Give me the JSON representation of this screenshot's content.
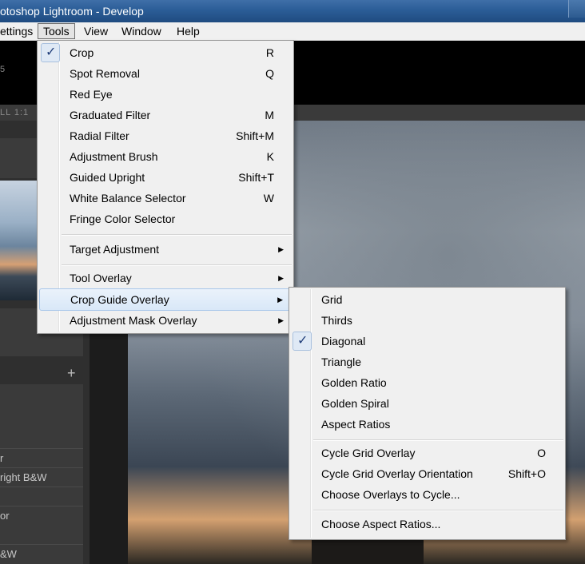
{
  "window": {
    "title": "otoshop Lightroom - Develop"
  },
  "menubar": {
    "items": [
      "ettings",
      "Tools",
      "View",
      "Window",
      "Help"
    ]
  },
  "lightroom": {
    "panel_hint": "5",
    "zoom_strip": "LL  1:1",
    "presets": [
      "r",
      "right B&W",
      "",
      "or",
      "&W"
    ]
  },
  "tools_menu": {
    "items": [
      {
        "label": "Crop",
        "shortcut": "R",
        "checked": true
      },
      {
        "label": "Spot Removal",
        "shortcut": "Q"
      },
      {
        "label": "Red Eye",
        "shortcut": ""
      },
      {
        "label": "Graduated Filter",
        "shortcut": "M"
      },
      {
        "label": "Radial Filter",
        "shortcut": "Shift+M"
      },
      {
        "label": "Adjustment Brush",
        "shortcut": "K"
      },
      {
        "label": "Guided Upright",
        "shortcut": "Shift+T"
      },
      {
        "label": "White Balance Selector",
        "shortcut": "W"
      },
      {
        "label": "Fringe Color Selector",
        "shortcut": ""
      }
    ],
    "target_adjustment": "Target Adjustment",
    "tool_overlay": "Tool Overlay",
    "crop_guide_overlay": "Crop Guide Overlay",
    "adjustment_mask_overlay": "Adjustment Mask Overlay"
  },
  "crop_guide_submenu": {
    "overlays": [
      {
        "label": "Grid"
      },
      {
        "label": "Thirds"
      },
      {
        "label": "Diagonal",
        "checked": true
      },
      {
        "label": "Triangle"
      },
      {
        "label": "Golden Ratio"
      },
      {
        "label": "Golden Spiral"
      },
      {
        "label": "Aspect Ratios"
      }
    ],
    "cycle_grid_overlay": {
      "label": "Cycle Grid Overlay",
      "shortcut": "O"
    },
    "cycle_grid_overlay_orientation": {
      "label": "Cycle Grid Overlay Orientation",
      "shortcut": "Shift+O"
    },
    "choose_overlays": "Choose Overlays to Cycle...",
    "choose_aspect_ratios": "Choose Aspect Ratios..."
  },
  "icons": {
    "check": "checkmark-icon",
    "submenu": "submenu-arrow-icon",
    "plus": "add-preset-icon"
  }
}
